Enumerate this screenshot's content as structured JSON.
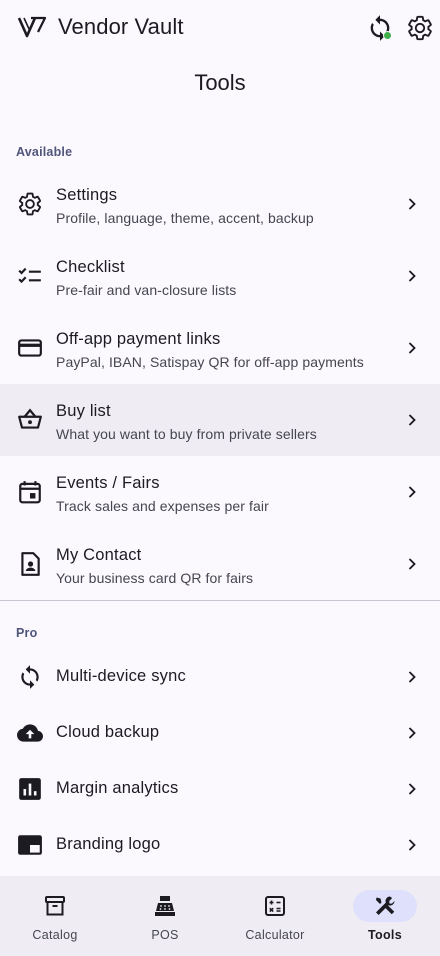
{
  "app": {
    "title": "Vendor Vault"
  },
  "page": {
    "title": "Tools"
  },
  "sections": {
    "available": "Available",
    "pro": "Pro"
  },
  "available_items": [
    {
      "title": "Settings",
      "subtitle": "Profile, language, theme, accent, backup",
      "icon": "gear-icon"
    },
    {
      "title": "Checklist",
      "subtitle": "Pre-fair and van-closure lists",
      "icon": "checklist-icon"
    },
    {
      "title": "Off-app payment links",
      "subtitle": "PayPal, IBAN, Satispay QR for off-app payments",
      "icon": "credit-card-icon"
    },
    {
      "title": "Buy list",
      "subtitle": "What you want to buy from private sellers",
      "icon": "basket-icon"
    },
    {
      "title": "Events / Fairs",
      "subtitle": "Track sales and expenses per fair",
      "icon": "calendar-icon"
    },
    {
      "title": "My Contact",
      "subtitle": "Your business card QR for fairs",
      "icon": "contact-card-icon"
    }
  ],
  "pro_items": [
    {
      "title": "Multi-device sync",
      "icon": "sync-icon"
    },
    {
      "title": "Cloud backup",
      "icon": "cloud-upload-icon"
    },
    {
      "title": "Margin analytics",
      "icon": "analytics-icon"
    },
    {
      "title": "Branding logo",
      "icon": "branding-logo-icon"
    }
  ],
  "nav": [
    {
      "label": "Catalog",
      "icon": "archive-box-icon"
    },
    {
      "label": "POS",
      "icon": "cash-register-icon"
    },
    {
      "label": "Calculator",
      "icon": "calculator-icon"
    },
    {
      "label": "Tools",
      "icon": "tools-icon",
      "active": true
    }
  ],
  "colors": {
    "background": "#fbf8fe",
    "highlight_row": "#efedf3",
    "section_label": "#50567a",
    "sync_status": "#3fae49",
    "nav_active_pill": "#dfe0fb"
  }
}
